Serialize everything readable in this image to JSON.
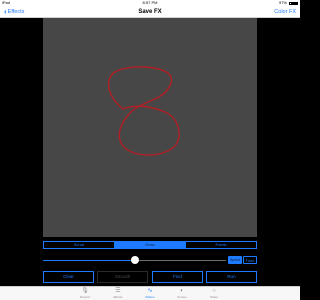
{
  "status_bar": {
    "carrier": "iPad",
    "time": "8:57 PM",
    "battery": "97%"
  },
  "nav": {
    "back_label": "Effects",
    "title": "Save FX",
    "right_label": "Color FX"
  },
  "segmented": {
    "items": [
      "Scrub",
      "Draw",
      "Points"
    ],
    "selected": "Draw"
  },
  "slider": {
    "value": 0.5
  },
  "slider_buttons": {
    "left": "Speed",
    "right": "Fixed"
  },
  "actions": {
    "clear": "Clear",
    "smooth": "Smooth",
    "find": "Find",
    "run": "Run"
  },
  "tabs": [
    {
      "label": "Record",
      "icon": "microphone-icon"
    },
    {
      "label": "Effects",
      "icon": "sliders-icon"
    },
    {
      "label": "Motion",
      "icon": "waveform-icon"
    },
    {
      "label": "Screen",
      "icon": "dial-icon"
    },
    {
      "label": "Share",
      "icon": "circle-icon"
    }
  ],
  "active_tab": "Motion",
  "colors": {
    "accent": "#1e7bff",
    "canvas": "#474747",
    "stroke": "#b21f24"
  }
}
